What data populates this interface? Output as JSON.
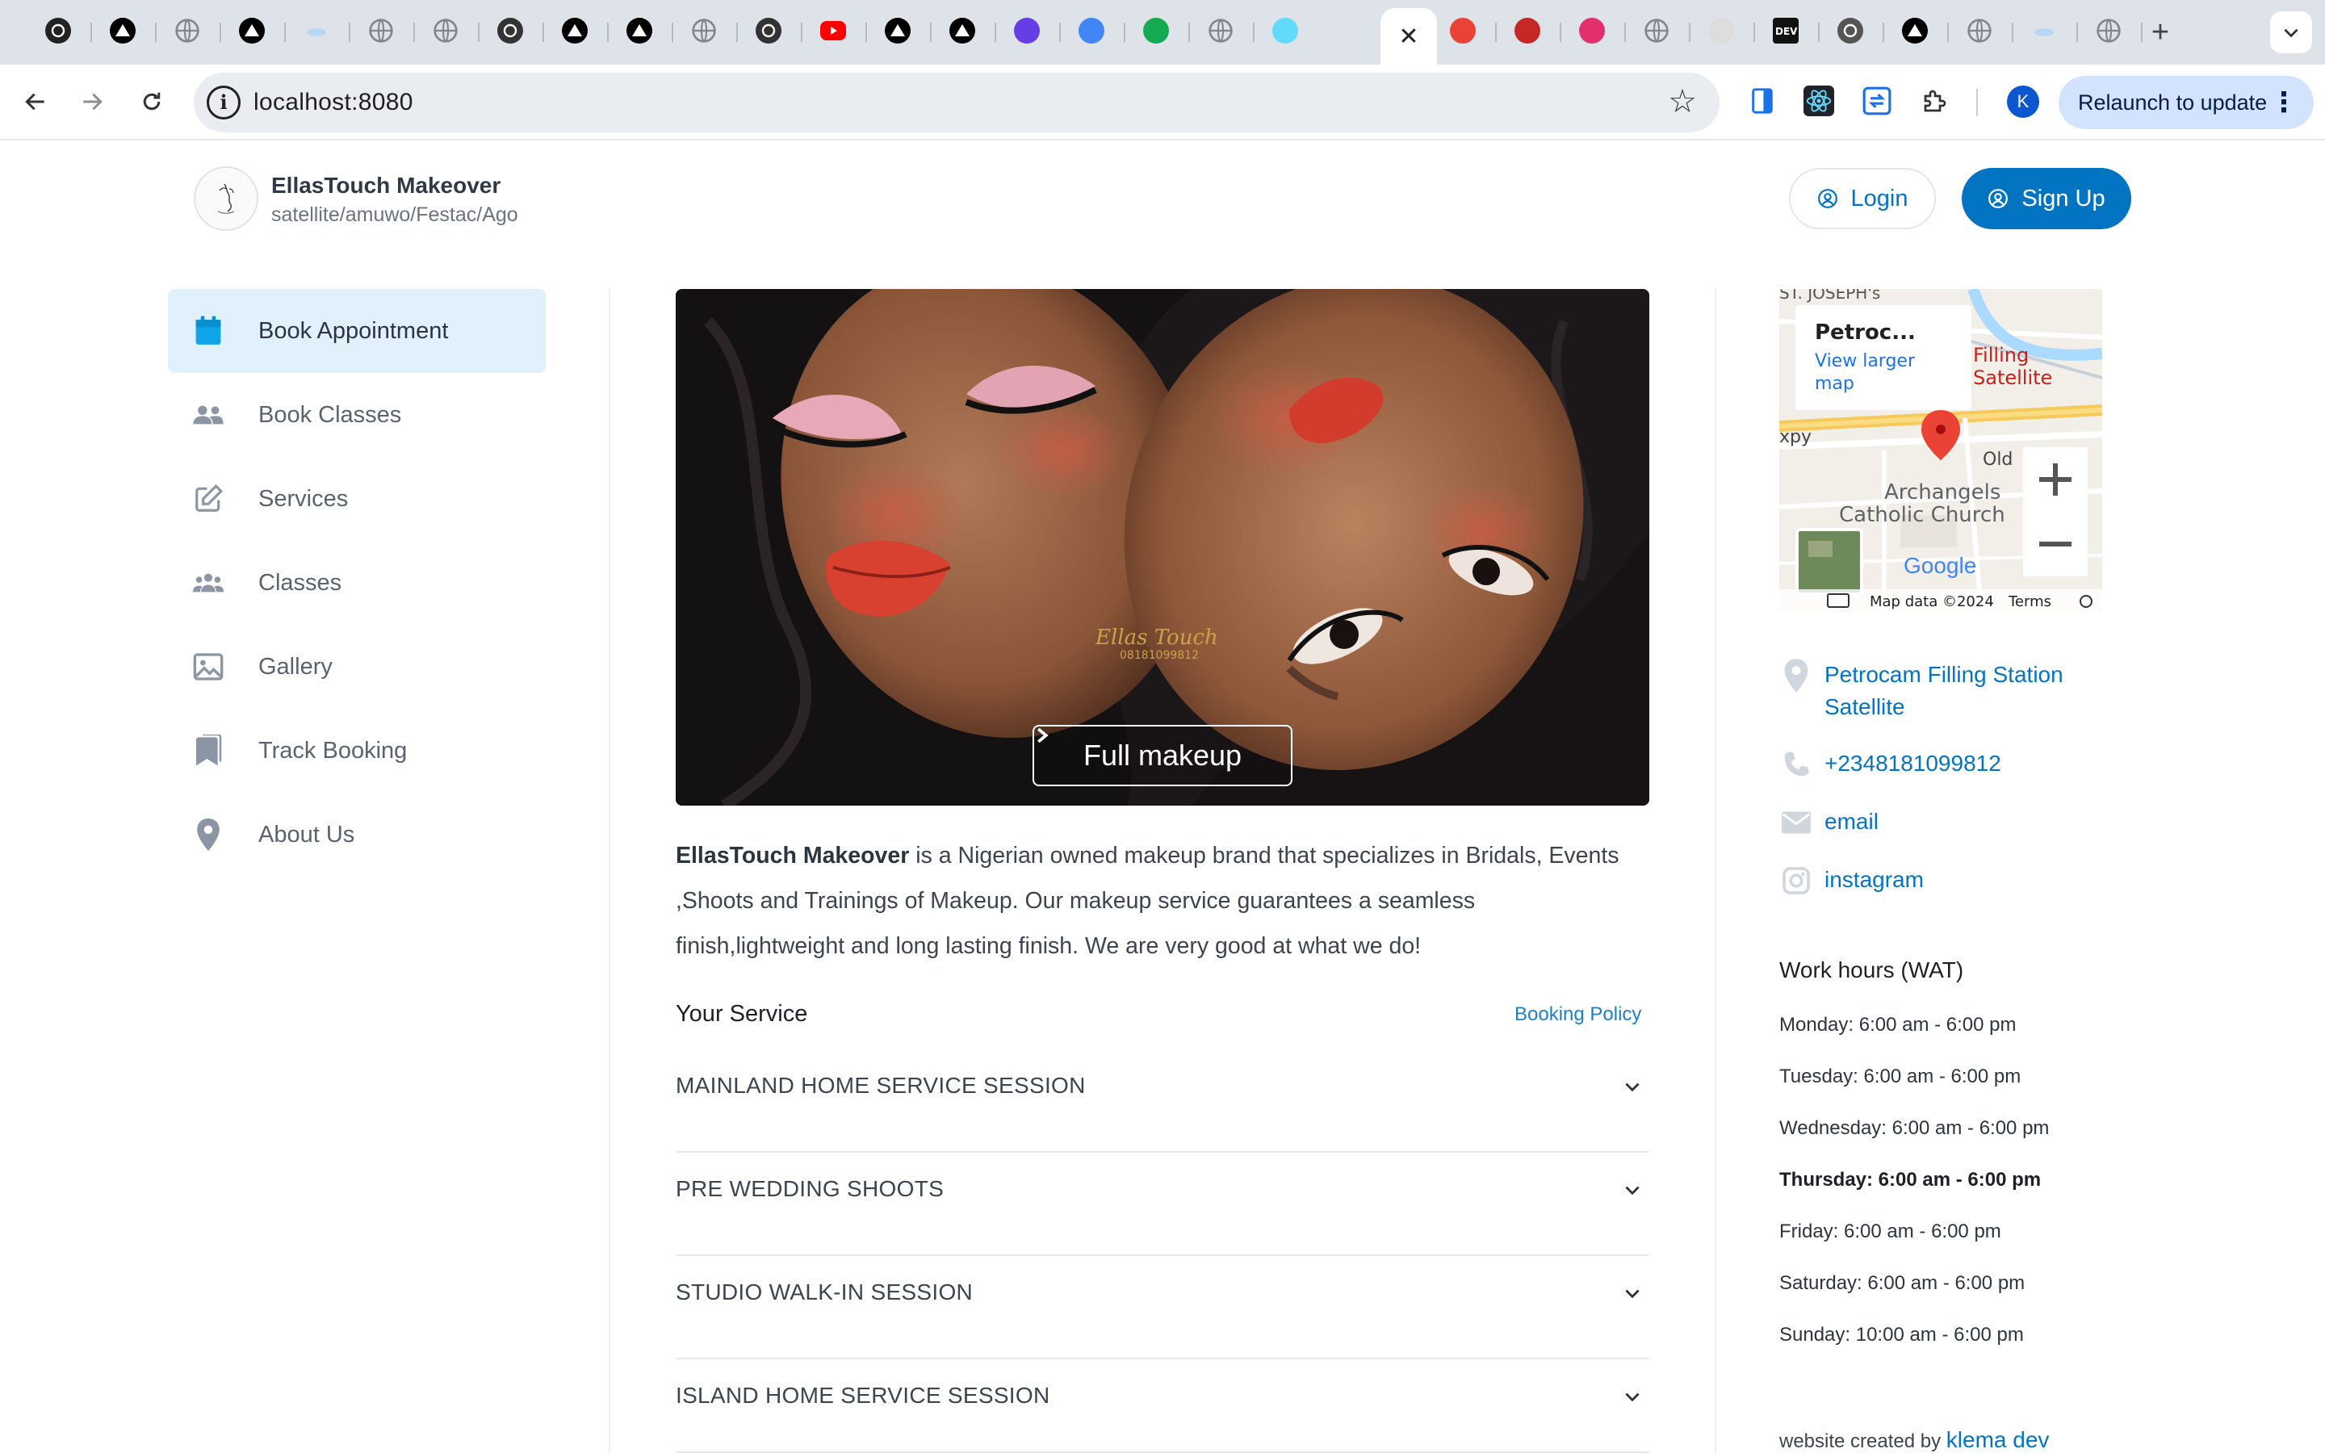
{
  "browser": {
    "url": "localhost:8080",
    "relaunch_label": "Relaunch to update",
    "profile_initial": "K",
    "active_tab_close": "✕",
    "new_tab": "+",
    "tab_favicons": [
      "openai-icon",
      "vercel-icon",
      "globe-icon",
      "vercel-icon",
      "cloud-icon",
      "globe-icon",
      "globe-icon",
      "github-icon",
      "vercel-icon",
      "vercel-icon",
      "globe-icon",
      "github-icon",
      "youtube-icon",
      "vercel-icon",
      "vercel-icon",
      "hostinger-icon",
      "google-icon",
      "mongodb-icon",
      "globe-icon",
      "react-icon",
      "dashboard-icon",
      "gmail-icon",
      "medium-icon",
      "instagram-icon",
      "globe-icon",
      "image-icon",
      "dev-icon",
      "chatgpt-icon",
      "vercel-icon",
      "globe-icon",
      "cloud-icon",
      "globe-icon"
    ]
  },
  "header": {
    "brand_name": "EllasTouch Makeover",
    "brand_location": "satellite/amuwo/Festac/Ago",
    "login_label": "Login",
    "signup_label": "Sign Up"
  },
  "sidebar": {
    "items": [
      {
        "label": "Book Appointment",
        "icon": "calendar-icon",
        "active": true
      },
      {
        "label": "Book Classes",
        "icon": "people-icon",
        "active": false
      },
      {
        "label": "Services",
        "icon": "edit-icon",
        "active": false
      },
      {
        "label": "Classes",
        "icon": "group-icon",
        "active": false
      },
      {
        "label": "Gallery",
        "icon": "image-icon",
        "active": false
      },
      {
        "label": "Track Booking",
        "icon": "bookmark-icon",
        "active": false
      },
      {
        "label": "About Us",
        "icon": "location-pin-icon",
        "active": false
      }
    ]
  },
  "hero": {
    "button_label": "Full makeup",
    "watermark_name": "Ellas Touch",
    "watermark_phone": "08181099812"
  },
  "about": {
    "brand": "EllasTouch Makeover",
    "text": " is a Nigerian owned makeup brand that specializes in Bridals, Events ,Shoots and Trainings of Makeup. Our makeup service guarantees a seamless finish,lightweight and long lasting finish. We are very good at what we do!"
  },
  "services": {
    "heading": "Your Service",
    "policy_link": "Booking Policy",
    "items": [
      "MAINLAND HOME SERVICE SESSION",
      "PRE WEDDING SHOOTS",
      "STUDIO WALK-IN SESSION",
      "ISLAND HOME SERVICE SESSION"
    ]
  },
  "map": {
    "place_title": "Petroc...",
    "view_larger": "View larger map",
    "label_church": "Archangels Catholic Church",
    "label_st_joseph": "ST. JOSEPH's",
    "label_filling": "Filling",
    "label_satellite": "Satellite",
    "label_expy": "xpy",
    "label_old": "Old",
    "google_logo": "Google",
    "map_data": "Map data ©2024",
    "terms": "Terms"
  },
  "contact": {
    "address": "Petrocam Filling Station Satellite",
    "phone": "+2348181099812",
    "email": "email",
    "instagram": "instagram"
  },
  "hours": {
    "title": "Work hours (WAT)",
    "days": [
      "Monday: 6:00 am - 6:00 pm",
      "Tuesday: 6:00 am - 6:00 pm",
      "Wednesday: 6:00 am - 6:00 pm",
      "Thursday: 6:00 am - 6:00 pm",
      "Friday: 6:00 am - 6:00 pm",
      "Saturday: 6:00 am - 6:00 pm",
      "Sunday: 10:00 am - 6:00 pm"
    ],
    "highlighted_day": "Thursday: 6:00 am - 6:00 pm"
  },
  "footer": {
    "credit_prefix": "website created by ",
    "credit_link": "klema dev"
  },
  "colors": {
    "primary": "#0274c2",
    "active_bg": "#e1f1fb",
    "calendar_icon": "#0ea5e9",
    "map_pin": "#ea4335",
    "tabstrip_bg": "#dee3ea",
    "relaunch_bg": "#d3e3fd"
  }
}
